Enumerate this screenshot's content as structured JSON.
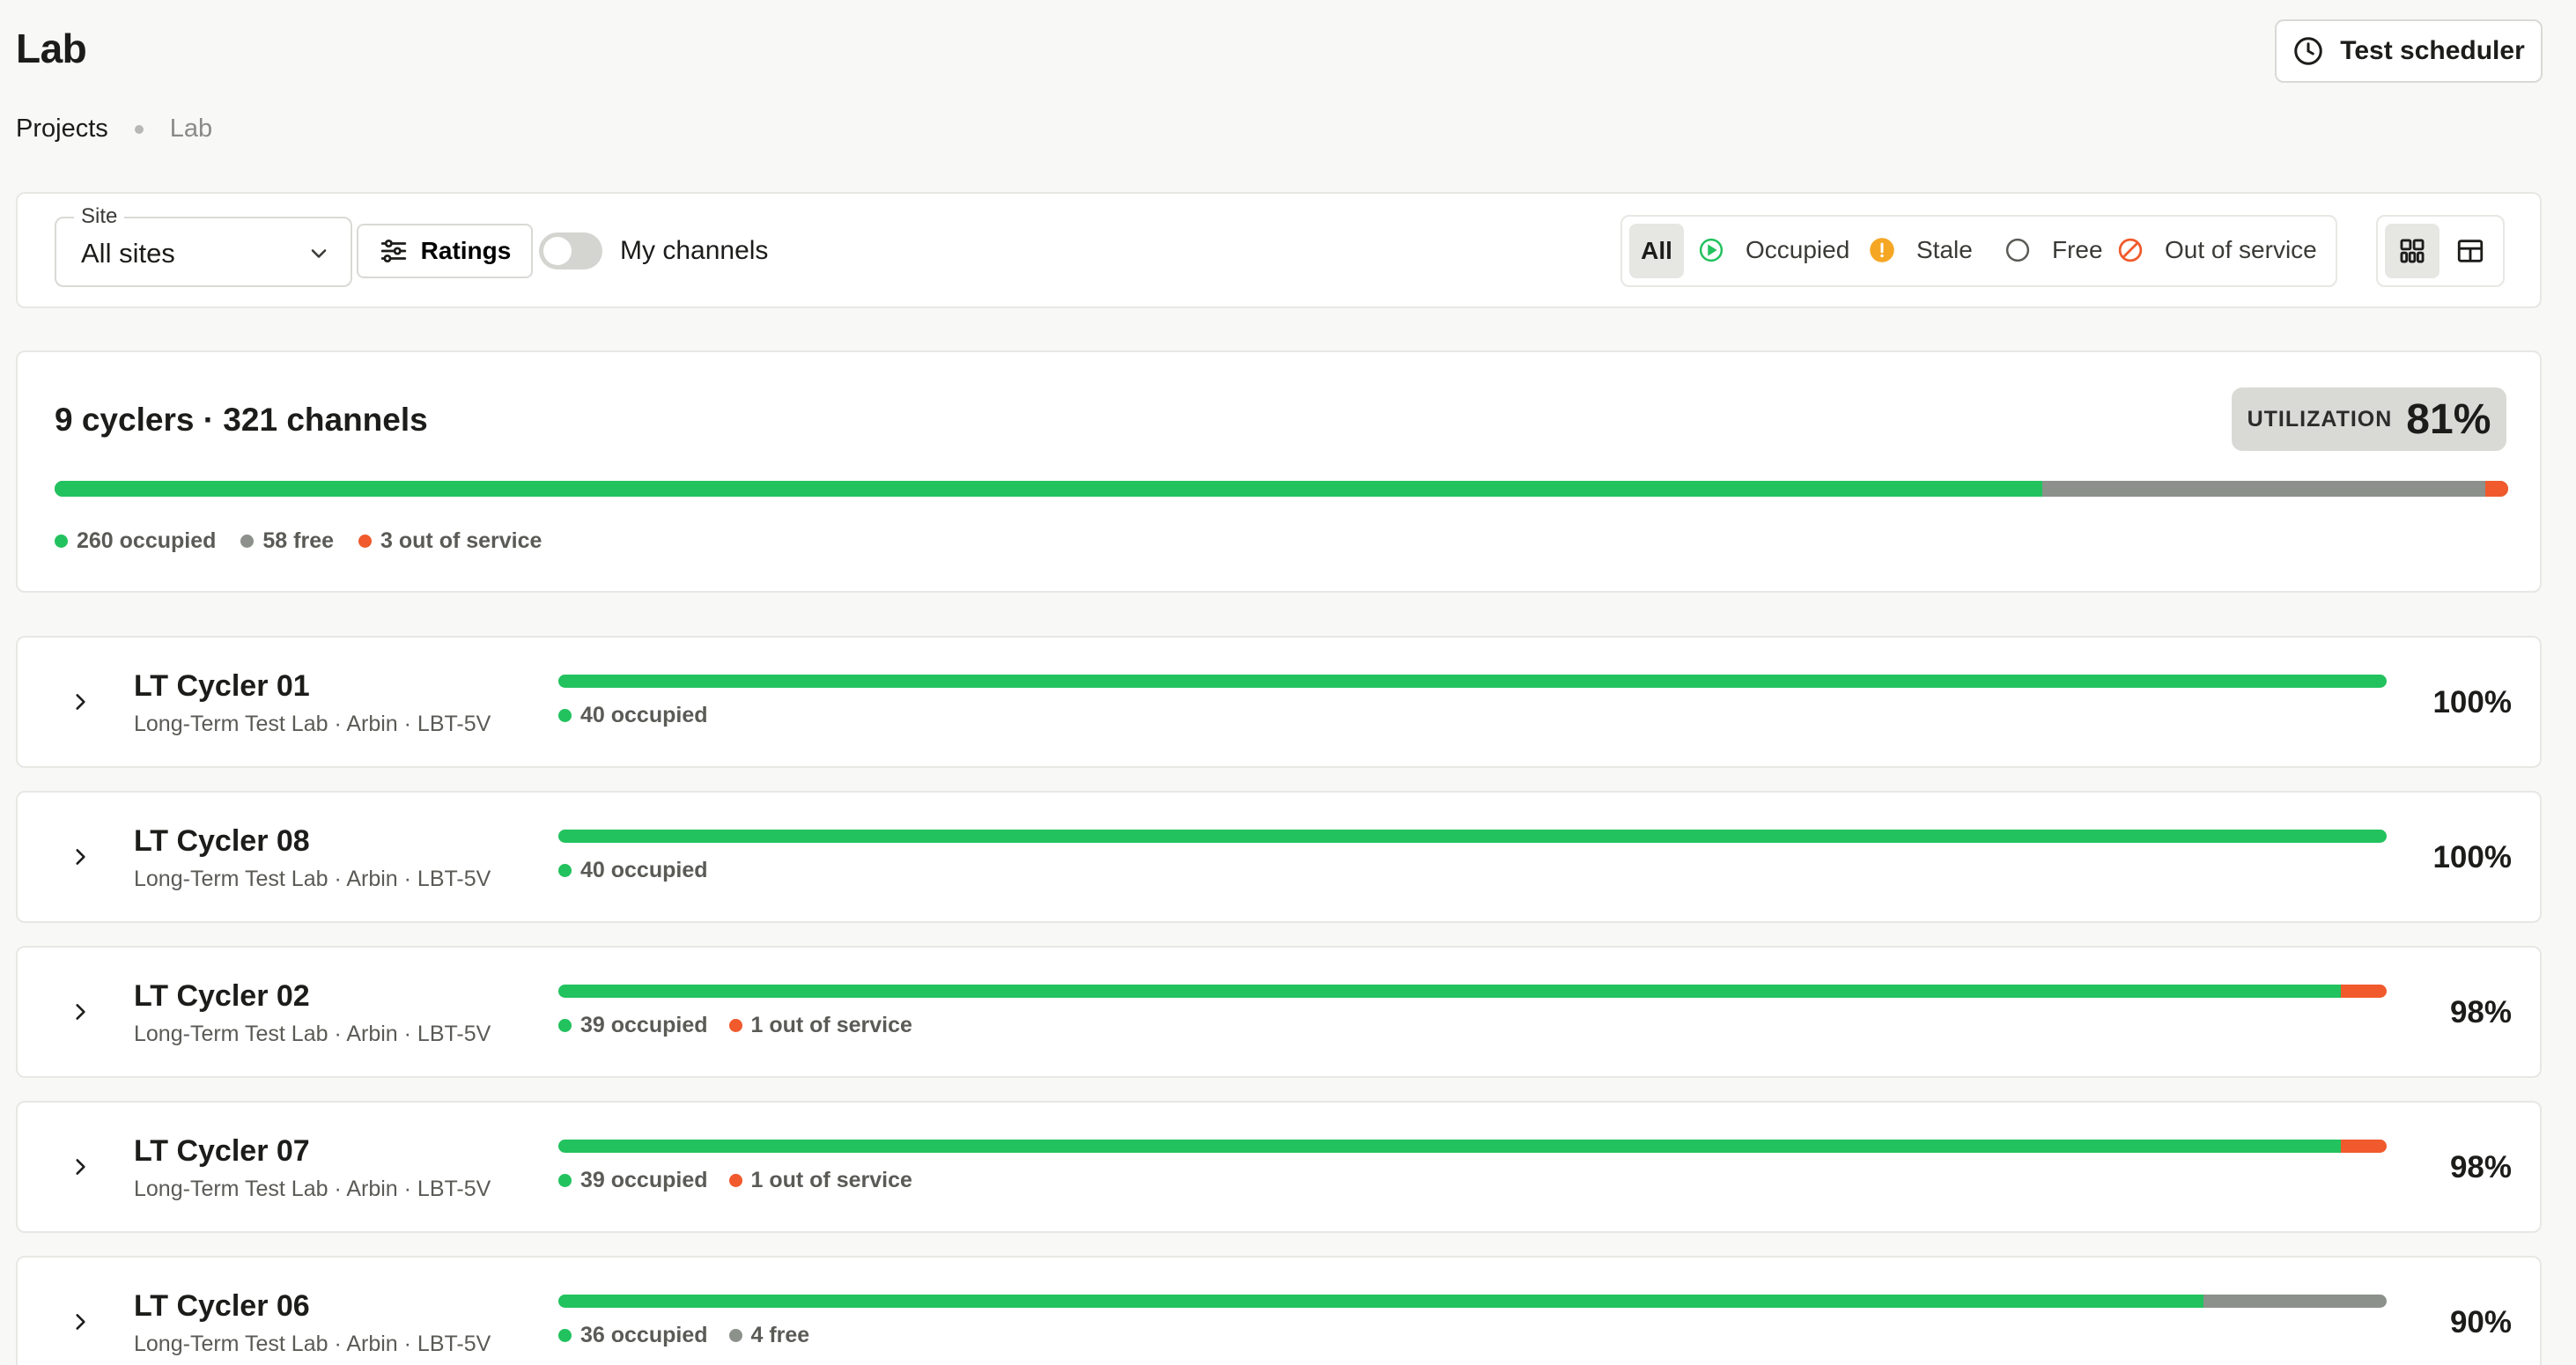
{
  "header": {
    "title": "Lab",
    "scheduler_label": "Test scheduler"
  },
  "breadcrumb": {
    "parent": "Projects",
    "current": "Lab"
  },
  "filters": {
    "site_label": "Site",
    "site_value": "All sites",
    "ratings_label": "Ratings",
    "my_channels_label": "My channels",
    "my_channels_on": false,
    "status": {
      "all": "All",
      "occupied": "Occupied",
      "stale": "Stale",
      "free": "Free",
      "out_of_service": "Out of service"
    }
  },
  "colors": {
    "occupied": "#22c25e",
    "free": "#8c918b",
    "out_of_service": "#f05a2c",
    "stale": "#f5a623"
  },
  "summary": {
    "title": "9 cyclers · 321 channels",
    "utilization_label": "UTILIZATION",
    "utilization_value": "81%",
    "occupied": 260,
    "free": 58,
    "out_of_service": 3,
    "occupied_label": "260 occupied",
    "free_label": "58 free",
    "oos_label": "3 out of service"
  },
  "cyclers": [
    {
      "name": "LT Cycler 01",
      "meta": "Long-Term Test Lab · Arbin · LBT-5V",
      "occupied": 40,
      "free": 0,
      "out_of_service": 0,
      "legend": [
        "40 occupied"
      ],
      "pct": "100%"
    },
    {
      "name": "LT Cycler 08",
      "meta": "Long-Term Test Lab · Arbin · LBT-5V",
      "occupied": 40,
      "free": 0,
      "out_of_service": 0,
      "legend": [
        "40 occupied"
      ],
      "pct": "100%"
    },
    {
      "name": "LT Cycler 02",
      "meta": "Long-Term Test Lab · Arbin · LBT-5V",
      "occupied": 39,
      "free": 0,
      "out_of_service": 1,
      "legend": [
        "39 occupied",
        "1 out of service"
      ],
      "pct": "98%"
    },
    {
      "name": "LT Cycler 07",
      "meta": "Long-Term Test Lab · Arbin · LBT-5V",
      "occupied": 39,
      "free": 0,
      "out_of_service": 1,
      "legend": [
        "39 occupied",
        "1 out of service"
      ],
      "pct": "98%"
    },
    {
      "name": "LT Cycler 06",
      "meta": "Long-Term Test Lab · Arbin · LBT-5V",
      "occupied": 36,
      "free": 4,
      "out_of_service": 0,
      "legend": [
        "36 occupied",
        "4 free"
      ],
      "pct": "90%"
    }
  ]
}
